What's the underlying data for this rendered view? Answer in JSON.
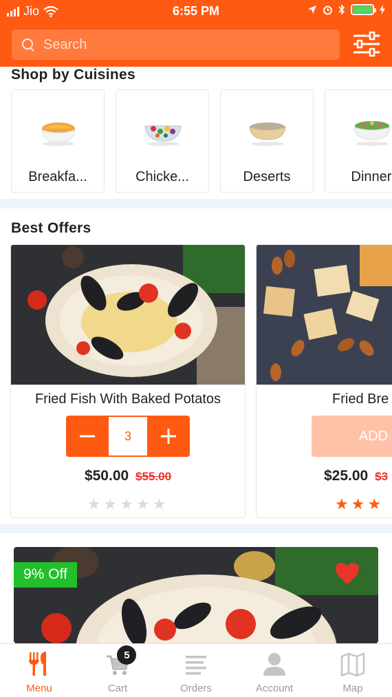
{
  "status_bar": {
    "carrier": "Jio",
    "time": "6:55 PM"
  },
  "search": {
    "placeholder": "Search"
  },
  "cuisines": {
    "title": "Shop by Cuisines",
    "items": [
      {
        "label": "Breakfa..."
      },
      {
        "label": "Chicke..."
      },
      {
        "label": "Deserts"
      },
      {
        "label": "Dinner"
      }
    ]
  },
  "offers": {
    "title": "Best Offers",
    "items": [
      {
        "name": "Fried Fish With Baked Potatos",
        "quantity": "3",
        "price": "$50.00",
        "old_price": "$55.00",
        "rating": 0,
        "stars": "★★★★★"
      },
      {
        "name": "Fried Bre",
        "button": "ADD",
        "price": "$25.00",
        "old_price": "$3",
        "rating": 3,
        "stars": "★★★"
      }
    ]
  },
  "promo": {
    "badge": "9% Off"
  },
  "tabs": [
    {
      "label": "Menu",
      "icon": "fork-knife-icon",
      "active": true
    },
    {
      "label": "Cart",
      "icon": "cart-icon",
      "badge": "5"
    },
    {
      "label": "Orders",
      "icon": "orders-list-icon"
    },
    {
      "label": "Account",
      "icon": "account-icon"
    },
    {
      "label": "Map",
      "icon": "map-icon"
    }
  ],
  "colors": {
    "accent": "#ff5a12",
    "badge_green": "#22c02a",
    "strike_red": "#e8352a",
    "heart": "#e8352a"
  }
}
